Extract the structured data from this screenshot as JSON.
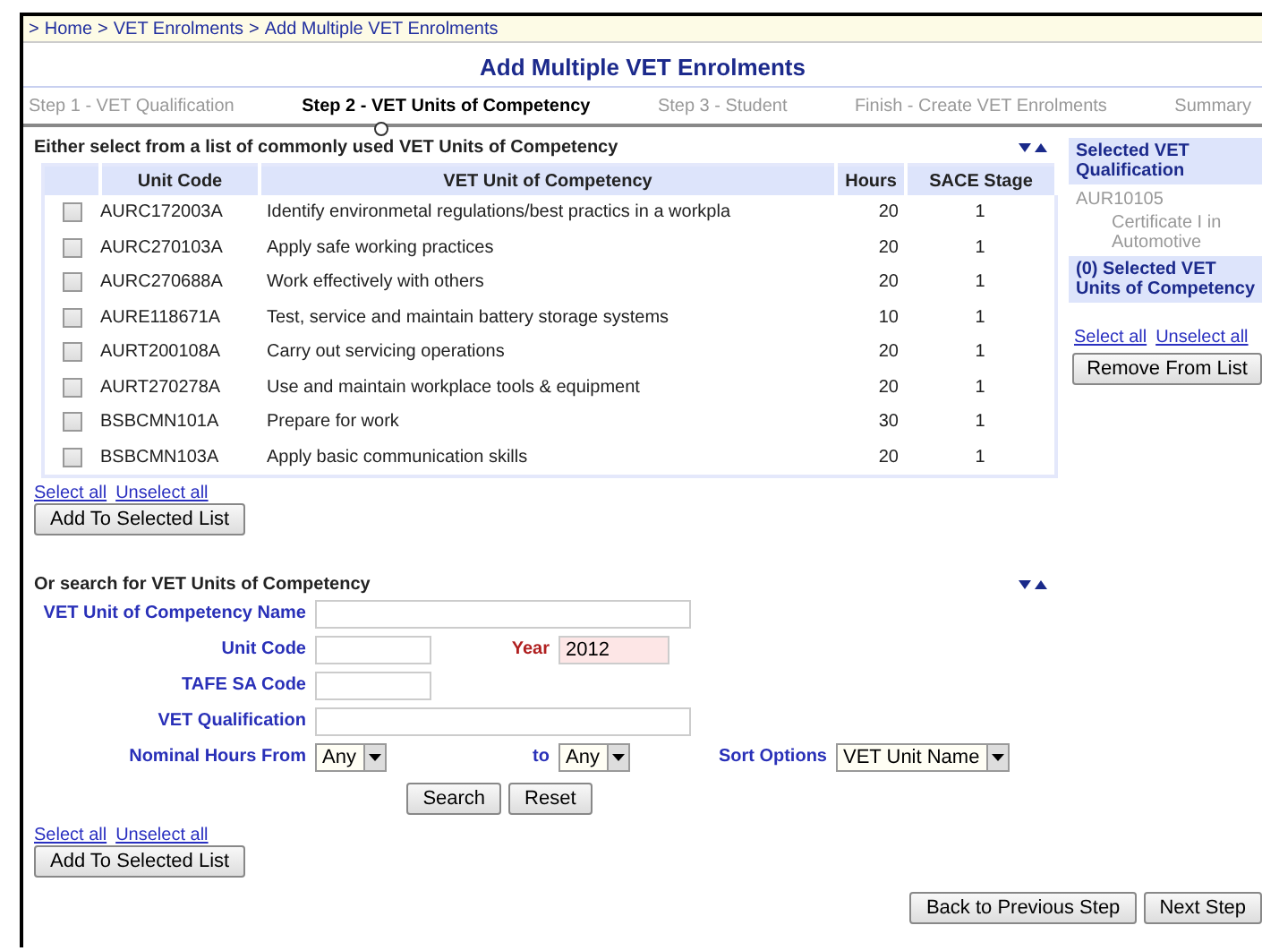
{
  "breadcrumb": {
    "separator": ">",
    "items": [
      "Home",
      "VET Enrolments",
      "Add Multiple VET Enrolments"
    ]
  },
  "title": "Add Multiple VET Enrolments",
  "steps": [
    {
      "label": "Step 1 - VET Qualification",
      "selected": false
    },
    {
      "label": "Step 2 - VET Units of Competency",
      "selected": true
    },
    {
      "label": "Step 3 - Student",
      "selected": false
    },
    {
      "label": "Finish - Create VET Enrolments",
      "selected": false
    },
    {
      "label": "Summary",
      "selected": false
    }
  ],
  "units": {
    "heading": "Either select from a list of commonly used VET Units of Competency",
    "columns": [
      "Unit Code",
      "VET Unit of Competency",
      "Hours",
      "SACE Stage"
    ],
    "rows": [
      {
        "code": "AURC172003A",
        "name": "Identify environmetal regulations/best practics in a workpla",
        "hours": "20",
        "stage": "1",
        "checked": false
      },
      {
        "code": "AURC270103A",
        "name": "Apply safe working practices",
        "hours": "20",
        "stage": "1",
        "checked": false
      },
      {
        "code": "AURC270688A",
        "name": "Work effectively with others",
        "hours": "20",
        "stage": "1",
        "checked": false
      },
      {
        "code": "AURE118671A",
        "name": "Test, service and maintain battery storage systems",
        "hours": "10",
        "stage": "1",
        "checked": false
      },
      {
        "code": "AURT200108A",
        "name": "Carry out servicing operations",
        "hours": "20",
        "stage": "1",
        "checked": false
      },
      {
        "code": "AURT270278A",
        "name": "Use and maintain workplace tools & equipment",
        "hours": "20",
        "stage": "1",
        "checked": false
      },
      {
        "code": "BSBCMN101A",
        "name": "Prepare for work",
        "hours": "30",
        "stage": "1",
        "checked": false
      },
      {
        "code": "BSBCMN103A",
        "name": "Apply basic communication skills",
        "hours": "20",
        "stage": "1",
        "checked": false
      }
    ],
    "select_all": "Select all",
    "unselect_all": "Unselect all",
    "add_button": "Add To Selected List"
  },
  "sidebar": {
    "qualification_heading": "Selected VET Qualification",
    "qualification_code": "AUR10105",
    "qualification_name": "Certificate I in Automotive",
    "units_heading": "(0) Selected VET Units of Competency",
    "select_all": "Select all",
    "unselect_all": "Unselect all",
    "remove_button": "Remove From List"
  },
  "search": {
    "heading": "Or search for VET Units of Competency",
    "rows": [
      [
        {
          "label": "VET Unit of Competency Name",
          "kind": "wide"
        }
      ],
      [
        {
          "label": "Unit Code",
          "kind": "short"
        },
        {
          "label": "Year",
          "kind": "short",
          "value": "2012",
          "highlighted": true
        }
      ],
      [
        {
          "label": "TAFE SA Code",
          "kind": "short"
        }
      ],
      [
        {
          "label": "VET Qualification",
          "kind": "wide"
        }
      ],
      [
        {
          "label": "Nominal Hours From",
          "kind": "select",
          "value": "Any"
        },
        {
          "label": "to",
          "kind": "select",
          "value": "Any"
        },
        {
          "label": "Sort Options",
          "kind": "select",
          "value": "VET Unit Name"
        }
      ]
    ],
    "buttons": [
      "Search",
      "Reset"
    ],
    "select_all": "Select all",
    "unselect_all": "Unselect all",
    "add_button": "Add To Selected List"
  },
  "footer_buttons": [
    "Back to Previous Step",
    "Next Step"
  ]
}
